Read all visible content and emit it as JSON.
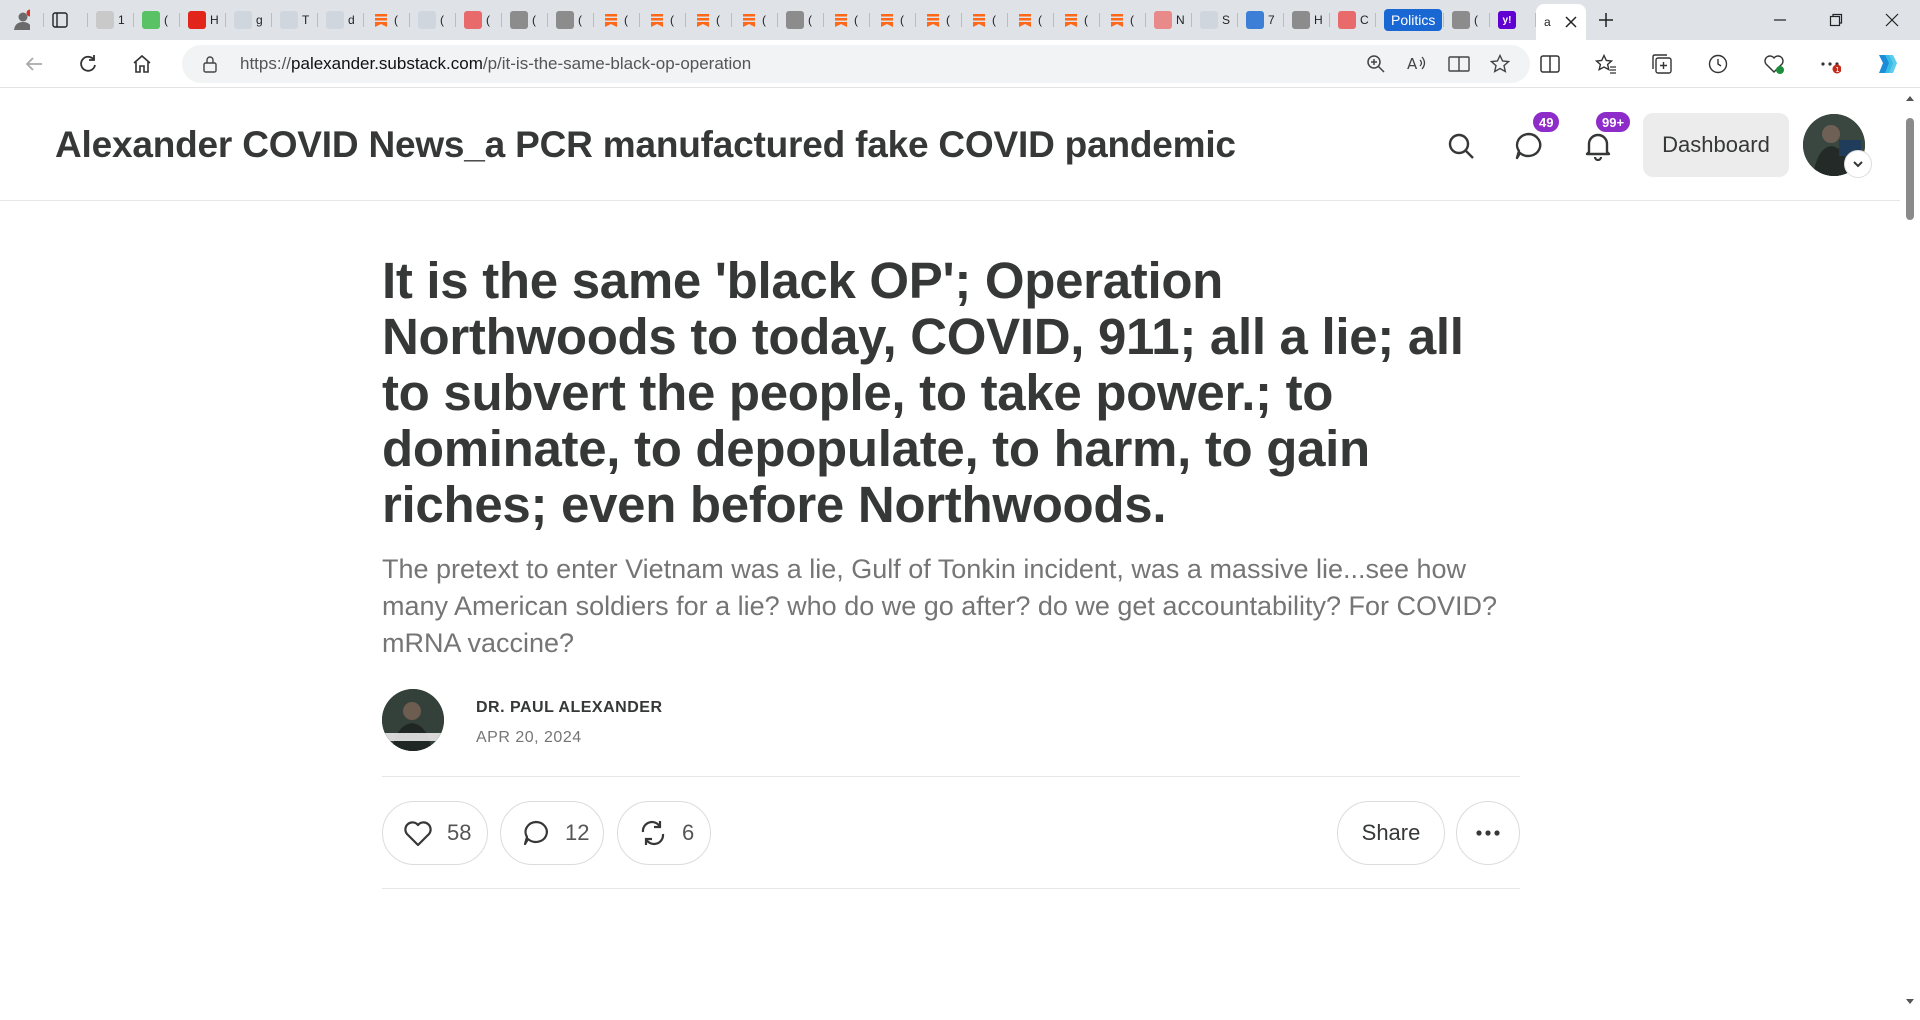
{
  "browser": {
    "tabs": [
      {
        "icon": "profile-icon",
        "title": ""
      },
      {
        "icon": "business-insider-icon",
        "title": "1"
      },
      {
        "icon": "g-icon",
        "title": "("
      },
      {
        "icon": "red-icon",
        "title": "H"
      },
      {
        "icon": "search-icon",
        "title": "g"
      },
      {
        "icon": "ds-icon",
        "title": "T"
      },
      {
        "icon": "settings-page-icon",
        "title": "d"
      },
      {
        "icon": "substack-icon",
        "title": "("
      },
      {
        "icon": "page-icon",
        "title": "("
      },
      {
        "icon": "youtube-icon",
        "title": "("
      },
      {
        "icon": "image-icon",
        "title": "("
      },
      {
        "icon": "image-icon",
        "title": "("
      },
      {
        "icon": "substack-icon",
        "title": "("
      },
      {
        "icon": "substack-icon",
        "title": "("
      },
      {
        "icon": "substack-icon",
        "title": "("
      },
      {
        "icon": "substack-icon",
        "title": "("
      },
      {
        "icon": "image-icon",
        "title": "("
      },
      {
        "icon": "substack-icon",
        "title": "("
      },
      {
        "icon": "substack-icon",
        "title": "("
      },
      {
        "icon": "substack-icon",
        "title": "("
      },
      {
        "icon": "substack-icon",
        "title": "("
      },
      {
        "icon": "substack-icon",
        "title": "("
      },
      {
        "icon": "substack-icon",
        "title": "("
      },
      {
        "icon": "substack-icon",
        "title": "("
      },
      {
        "icon": "t-icon",
        "title": "N"
      },
      {
        "icon": "lrc-icon",
        "title": "S"
      },
      {
        "icon": "wordpress-icon",
        "title": "7"
      },
      {
        "icon": "image-icon",
        "title": "H"
      },
      {
        "icon": "youtube-icon",
        "title": "C"
      }
    ],
    "politics_tab": "Politics",
    "active_tab_title": "a",
    "url_host": "palexander.substack.com",
    "url_prefix": "https://",
    "url_path": "/p/it-is-the-same-black-op-operation",
    "colors": {
      "tabstrip": "#dfe3e8",
      "accent": "#1967d2"
    }
  },
  "header": {
    "site_title": "Alexander COVID News_a PCR manufactured fake COVID pandemic",
    "messages_badge": "49",
    "notifications_badge": "99+",
    "dashboard_label": "Dashboard",
    "badge_color": "#8e2cc9"
  },
  "post": {
    "title": "It is the same 'black OP'; Operation Northwoods to today, COVID, 911; all a lie; all to subvert the people, to take power.; to dominate, to depopulate, to harm, to gain riches; even before Northwoods.",
    "subtitle": "The pretext to enter Vietnam was a lie, Gulf of Tonkin incident, was a massive lie...see how many American soldiers for a lie? who do we go after? do we get accountability? For COVID? mRNA vaccine?",
    "author": "DR. PAUL ALEXANDER",
    "date": "APR 20, 2024",
    "likes": "58",
    "comments": "12",
    "restacks": "6",
    "share_label": "Share"
  }
}
